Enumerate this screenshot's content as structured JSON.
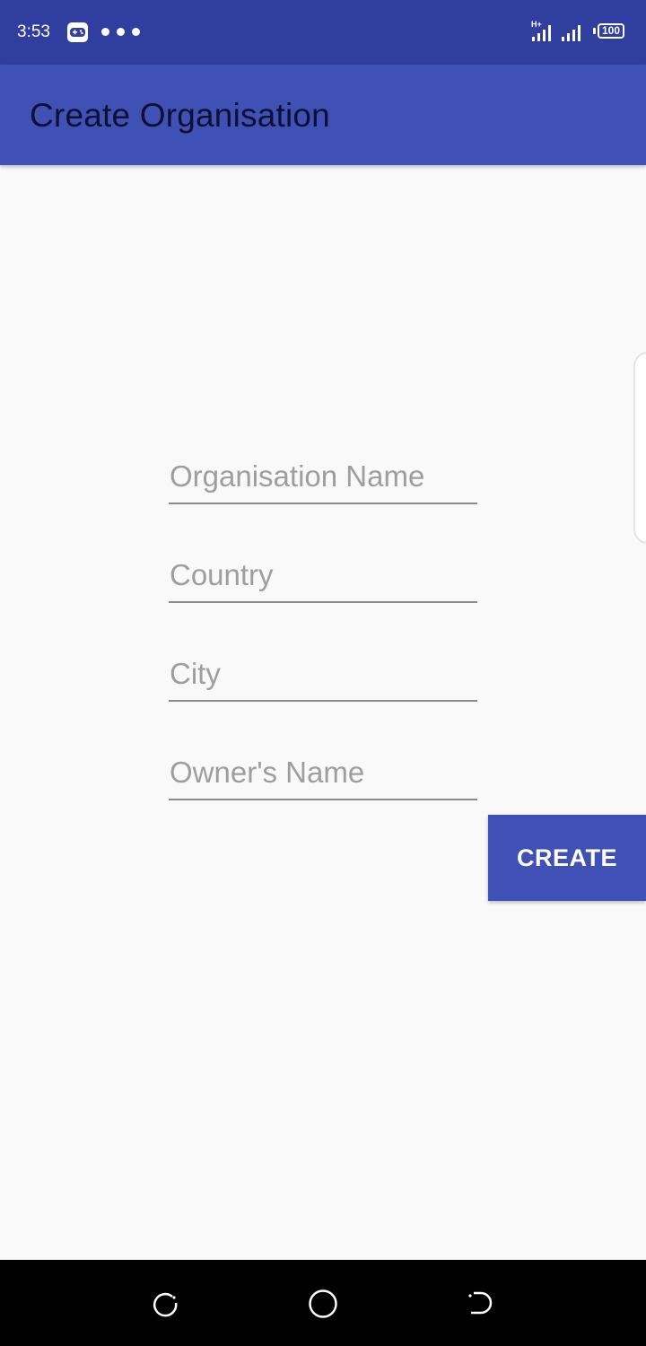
{
  "status_bar": {
    "time": "3:53",
    "icons": [
      "game-controller-icon",
      "more-dots-icon",
      "signal-h-plus-icon",
      "signal-icon",
      "battery-icon"
    ],
    "battery_level": "100"
  },
  "app_bar": {
    "title": "Create Organisation",
    "color": "#3f51b5"
  },
  "form": {
    "fields": [
      {
        "placeholder": "Organisation Name",
        "value": ""
      },
      {
        "placeholder": "Country",
        "value": ""
      },
      {
        "placeholder": "City",
        "value": ""
      },
      {
        "placeholder": "Owner's Name",
        "value": ""
      }
    ],
    "create_label": "CREATE"
  },
  "nav_bar": {
    "icons": [
      "recent-apps-icon",
      "home-icon",
      "back-icon"
    ]
  },
  "colors": {
    "status_bar": "#303f9f",
    "primary": "#3f51b5",
    "background": "#f9f9f9"
  }
}
